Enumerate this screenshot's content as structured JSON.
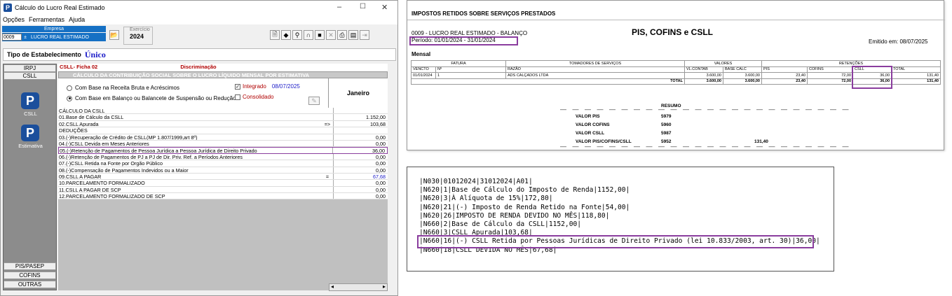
{
  "window": {
    "title": "Cálculo do Lucro Real Estimado",
    "icon": "P"
  },
  "menu": [
    "Opções",
    "Ferramentas",
    "Ajuda"
  ],
  "empresa": {
    "label": "Empresa",
    "code": "0009",
    "name": "LUCRO REAL ESTIMADO"
  },
  "exercicio": {
    "label": "Exercício",
    "value": "2024"
  },
  "tipo": {
    "label": "Tipo de Estabelecimento",
    "value": "Único"
  },
  "nav": {
    "top": [
      "IRPJ",
      "CSLL"
    ],
    "big1": "CSLL",
    "big2": "Estimativa",
    "bottom": [
      "PIS/PASEP",
      "COFINS",
      "OUTRAS"
    ]
  },
  "ficha": {
    "title": "CSLL- Ficha 02",
    "col": "Discriminação",
    "subtitle": "CÁLCULO DA CONTRIBUIÇÃO SOCIAL SOBRE O LUCRO LÍQUIDO MENSAL POR ESTIMATIVA",
    "opt1": "Com Base na  Receita Bruta e Acréscimos",
    "opt2": "Com Base em Balanço ou Balancete de Suspensão ou Redução",
    "integrado": "Integrado",
    "date": "08/07/2025",
    "consolidado": "Consolidado",
    "month": "Janeiro"
  },
  "rows": [
    {
      "d": "CÁLCULO DA CSLL",
      "m": "",
      "v": ""
    },
    {
      "d": "01.Base de Cálculo da CSLL",
      "m": "",
      "v": "1.152,00"
    },
    {
      "d": "02.CSLL Apurada",
      "m": "=>",
      "v": "103,68"
    },
    {
      "d": "DEDUÇÕES",
      "m": "",
      "v": ""
    },
    {
      "d": "  03.(-)Recuperação de Crédito de CSLL(MP 1.807/1999,art 8º)",
      "m": "",
      "v": "0,00"
    },
    {
      "d": "  04.(-)CSLL Devida em Meses Anteriores",
      "m": "",
      "v": "0,00"
    },
    {
      "d": "05.(-)Retenção de Pagamentos de Pessoa Jurídica a Pessoa Jurídica de Direito Privado",
      "m": "",
      "v": "36,00"
    },
    {
      "d": "  06.(-)Retenção de Pagamentos de PJ a PJ de Dir. Priv. Ref. a Períodos Anteriores",
      "m": "",
      "v": "0,00"
    },
    {
      "d": "  07.(-)CSLL Retida na Fonte por Orgão Público",
      "m": "",
      "v": "0,00"
    },
    {
      "d": "  08.(-)Compensação de Pagamentos Indevidos ou a Maior",
      "m": "",
      "v": "0,00"
    },
    {
      "d": "09.CSLL A PAGAR",
      "m": "=",
      "v": "67,68"
    },
    {
      "d": "10.PARCELAMENTO FORMALIZADO",
      "m": "",
      "v": "0,00"
    },
    {
      "d": "11.CSLL A PAGAR DE SCP",
      "m": "",
      "v": "0,00"
    },
    {
      "d": "12.PARCELAMENTO FORMALIZADO DE SCP",
      "m": "",
      "v": "0,00"
    }
  ],
  "report": {
    "header": "IMPOSTOS RETIDOS SOBRE SERVIÇOS PRESTADOS",
    "company": "0009 - LUCRO REAL ESTIMADO - BALANÇO",
    "periodo": "Período: 01/01/2024 - 31/01/2024",
    "title": "PIS, COFINS e CSLL",
    "emitido": "Emitido em: 08/07/2025",
    "mensal": "Mensal",
    "groups": [
      "FATURA",
      "TOMADORES DE SERVIÇOS",
      "VALORES",
      "RETENÇÕES"
    ],
    "cols": [
      "VENCTO",
      "Nº",
      "RAZÃO",
      "VL.CONTAB",
      "BASE CALC",
      "PIS",
      "COFINS",
      "CSLL",
      "TOTAL"
    ],
    "line": [
      "01/01/2024",
      "1",
      "ADS CALÇADOS LTDA",
      "3.600,00",
      "3.600,00",
      "23,40",
      "72,00",
      "36,00",
      "131,40"
    ],
    "total_label": "TOTAL",
    "total": [
      "3.600,00",
      "3.600,00",
      "23,40",
      "72,00",
      "36,00",
      "131,40"
    ],
    "resumo": "RESUMO",
    "summary": [
      {
        "k": "VALOR PIS",
        "c": "5979",
        "v": ""
      },
      {
        "k": "VALOR COFINS",
        "c": "5960",
        "v": ""
      },
      {
        "k": "VALOR CSLL",
        "c": "5987",
        "v": ""
      },
      {
        "k": "VALOR PIS/COFINS/CSLL",
        "c": "5952",
        "v": "131,40"
      }
    ]
  },
  "code_lines": [
    "|N030|01012024|31012024|A01|",
    "|N620|1|Base de Cálculo do Imposto de Renda|1152,00|",
    "|N620|3|À Alíquota de 15%|172,80|",
    "|N620|21|(-) Imposto de Renda Retido na Fonte|54,00|",
    "|N620|26|IMPOSTO DE RENDA DEVIDO NO MÊS|118,80|",
    "|N660|2|Base de Cálculo da CSLL|1152,00|",
    "|N660|3|CSLL Apurada|103,68|",
    "|N660|16|(-) CSLL Retida por Pessoas Jurídicas de Direito Privado (lei 10.833/2003, art. 30)|36,00|",
    "|N660|18|CSLL DEVIDA NO MÊS|67,68|"
  ]
}
